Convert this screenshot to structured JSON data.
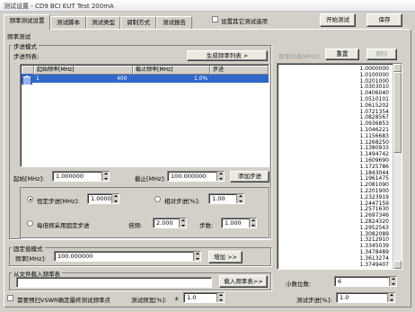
{
  "window": {
    "title": "测试设置 - CD9 BCI EUT Test 200mA"
  },
  "tabs": [
    "频率测试设置",
    "测试脚本",
    "测试类型",
    "调制方式",
    "测试报告"
  ],
  "top": {
    "other_options_label": "设置其它测试选项",
    "start_button": "开始测试",
    "save_button": "保存"
  },
  "panel_title": "频率测试",
  "step_mode": {
    "group_label": "步进模式",
    "list_label": "步进列表:",
    "generate_button": "生成频率列表 >",
    "columns": [
      "",
      "起始频率[MHz]",
      "截止频率[MHz]",
      "步进"
    ],
    "rows": [
      {
        "index": "1",
        "start": "1",
        "stop": "400",
        "step": "1.0%"
      }
    ],
    "start_label": "起始[MHz]:",
    "start_value": "1.000000",
    "stop_label": "截止[MHz]:",
    "stop_value": "100.000000",
    "add_step_button": "添加步进",
    "fixed_step_label": "恒定步进[MHz]:",
    "fixed_step_value": "1.000000",
    "relative_step_label": "相对步进[%]:",
    "relative_step_value": "1.00",
    "octave_label": "每倍频采用固定步进",
    "multiplier_label": "倍频:",
    "multiplier_value": "2.000",
    "steps_label": "步数:",
    "steps_value": "1.000"
  },
  "fixed_mode": {
    "group_label": "固定值模式",
    "freq_label": "频率[MHz]:",
    "freq_value": "100.000000",
    "add_button": "增加 >>"
  },
  "file_load": {
    "group_label": "从文件载入频率表",
    "load_button": "载入频率表>>"
  },
  "freq_list": {
    "label": "频率列表[MHz]:",
    "reset_button": "重置",
    "delete_button": "删除",
    "values": [
      "1.0000000",
      "1.0100000",
      "1.0201000",
      "1.0303010",
      "1.0406040",
      "1.0510101",
      "1.0615202",
      "1.0721354",
      "1.0828567",
      "1.0936853",
      "1.1046221",
      "1.1156683",
      "1.1268250",
      "1.1380933",
      "1.1494742",
      "1.1609690",
      "1.1725786",
      "1.1843044",
      "1.1961475",
      "1.2081090",
      "1.2201900",
      "1.2323919",
      "1.2447159",
      "1.2571630",
      "1.2697346",
      "1.2824320",
      "1.2952563",
      "1.3082089",
      "1.3212910",
      "1.3345039",
      "1.3478489",
      "1.3613274",
      "1.3749407"
    ]
  },
  "decimals": {
    "label": "小数位数:",
    "value": "6"
  },
  "bottom": {
    "vswr_label": "需要预扫VSWR确定最终测试频率点",
    "bandwidth_label": "测试频宽[%]:",
    "bandwidth_pm": "±",
    "bandwidth_value": "1.0",
    "step_label": "测试步进[%]:",
    "step_value": "1.0"
  }
}
